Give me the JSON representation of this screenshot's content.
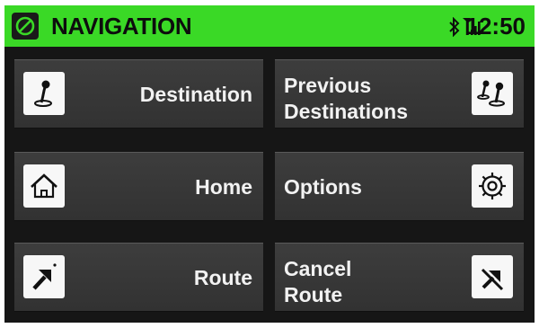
{
  "header": {
    "title": "NAVIGATION",
    "time": "12:50",
    "icons": {
      "app": "navigation-compass-icon",
      "bluetooth": "bluetooth-icon",
      "signal": "signal-strength-icon"
    }
  },
  "buttons": {
    "destination": {
      "label": "Destination",
      "icon": "destination-pin-icon"
    },
    "previous_destinations": {
      "line1": "Previous",
      "line2": "Destinations",
      "icon": "previous-destinations-pins-icon"
    },
    "home": {
      "label": "Home",
      "icon": "home-icon"
    },
    "options": {
      "label": "Options",
      "icon": "gear-icon"
    },
    "route": {
      "label": "Route",
      "icon": "route-arrow-icon"
    },
    "cancel_route": {
      "line1": "Cancel",
      "line2": "Route",
      "icon": "cancel-route-icon"
    }
  },
  "colors": {
    "header_green": "#3ad926",
    "screen_bg": "#161616",
    "button_bg": "#383838",
    "button_text": "#f2f2f2"
  }
}
